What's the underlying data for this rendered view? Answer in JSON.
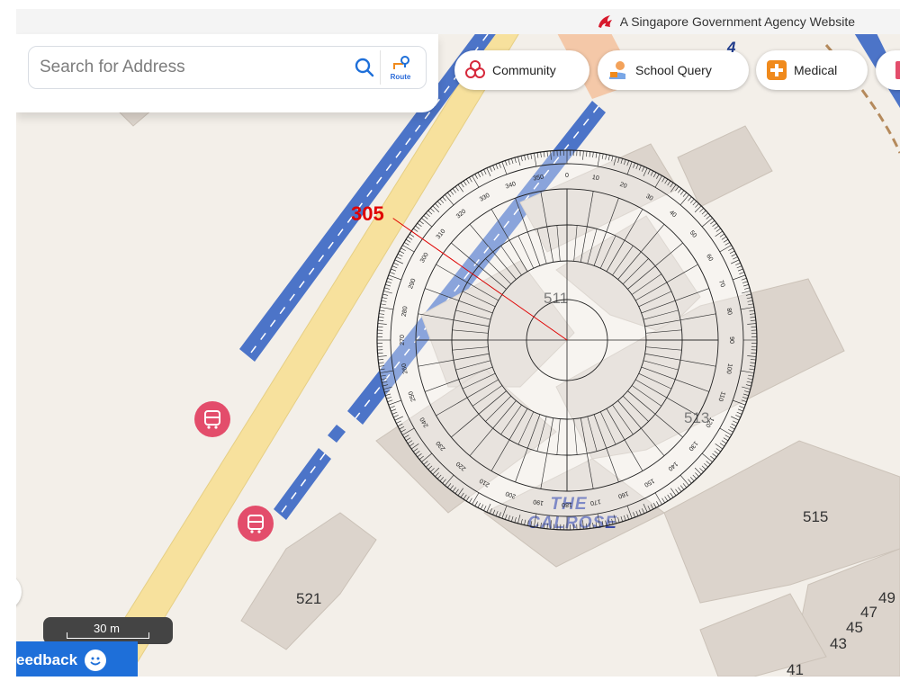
{
  "banner": {
    "text": "A Singapore Government Agency Website"
  },
  "search": {
    "placeholder": "Search for Address",
    "route_label": "Route"
  },
  "chips": [
    {
      "label": "Community",
      "icon": "community-icon"
    },
    {
      "label": "School Query",
      "icon": "school-query-icon"
    },
    {
      "label": "Medical",
      "icon": "medical-icon"
    }
  ],
  "map": {
    "building_labels": [
      "511",
      "513",
      "515",
      "521",
      "49",
      "47",
      "45",
      "43",
      "41"
    ],
    "estate_name_line1": "THE",
    "estate_name_line2": "CALROSE",
    "road_marker": "4"
  },
  "protractor": {
    "bearing": "305",
    "bearing_value": 305,
    "degree_labels": [
      "0",
      "10",
      "20",
      "30",
      "40",
      "50",
      "60",
      "70",
      "80",
      "90",
      "100",
      "110",
      "120",
      "130",
      "140",
      "150",
      "160",
      "170",
      "180",
      "190",
      "200",
      "210",
      "220",
      "230",
      "240",
      "250",
      "260",
      "270",
      "280",
      "290",
      "300",
      "310",
      "320",
      "330",
      "340",
      "350"
    ]
  },
  "scale": {
    "label": "30 m"
  },
  "feedback": {
    "label": "eedback"
  },
  "colors": {
    "road_blue": "#4c74c8",
    "road_yellow": "#f7e19d",
    "building": "#dcd4cc",
    "readout_red": "#e00000",
    "brand_blue": "#1e6fd9",
    "bus_stop": "#e34d6b"
  }
}
